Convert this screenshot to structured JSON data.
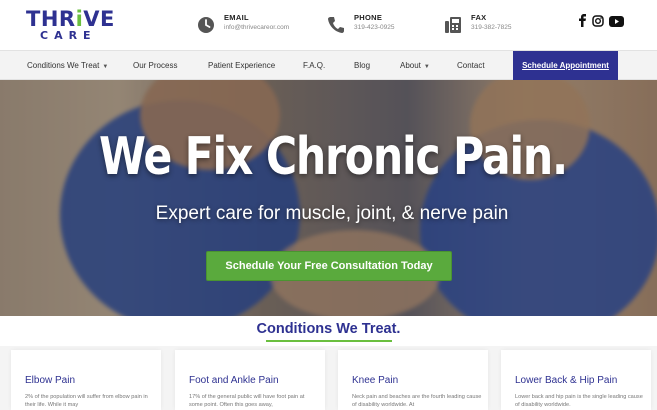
{
  "brand": {
    "logo_top_a": "THR",
    "logo_top_b": "i",
    "logo_top_c": "VE",
    "logo_bottom": "CARE",
    "primary_color": "#2e3191",
    "accent_color": "#6abf3f"
  },
  "contact": {
    "email": {
      "label": "EMAIL",
      "value": "info@thrivecareor.com",
      "icon": "clock-icon"
    },
    "phone": {
      "label": "PHONE",
      "value": "319-423-0925",
      "icon": "phone-icon"
    },
    "fax": {
      "label": "FAX",
      "value": "319-382-7825",
      "icon": "fax-icon"
    }
  },
  "social": [
    "facebook-icon",
    "instagram-icon",
    "youtube-icon"
  ],
  "nav": {
    "items": [
      {
        "label": "Conditions We Treat",
        "has_dropdown": true
      },
      {
        "label": "Our Process",
        "has_dropdown": false
      },
      {
        "label": "Patient Experience",
        "has_dropdown": false
      },
      {
        "label": "F.A.Q.",
        "has_dropdown": false
      },
      {
        "label": "Blog",
        "has_dropdown": false
      },
      {
        "label": "About",
        "has_dropdown": true
      },
      {
        "label": "Contact",
        "has_dropdown": false
      }
    ],
    "cta": "Schedule Appointment"
  },
  "hero": {
    "title": "We Fix Chronic Pain.",
    "subtitle": "Expert care for muscle, joint, & nerve pain",
    "button": "Schedule Your Free Consultation Today"
  },
  "conditions": {
    "title": "Conditions We Treat.",
    "cards": [
      {
        "title": "Elbow Pain",
        "text": "2% of the population will suffer from elbow pain in their life. While it may"
      },
      {
        "title": "Foot and Ankle Pain",
        "text": "17% of the general public will have foot pain at some point. Often this goes away,"
      },
      {
        "title": "Knee Pain",
        "text": "Neck pain and beaches are the fourth leading cause of disability worldwide. At"
      },
      {
        "title": "Lower Back & Hip Pain",
        "text": "Lower back and hip pain is the single leading cause of disability worldwide."
      }
    ]
  }
}
